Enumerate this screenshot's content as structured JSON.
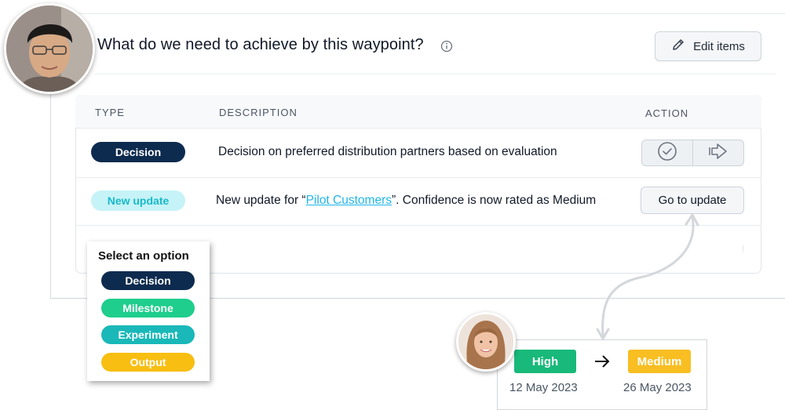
{
  "header": {
    "title": "What do we need to achieve by this waypoint?",
    "edit_label": "Edit items"
  },
  "table": {
    "columns": [
      "TYPE",
      "DESCRIPTION",
      "ACTION"
    ],
    "rows": [
      {
        "type": "Decision",
        "type_color": "#0d2b4e",
        "description": "Decision on preferred distribution partners based on evaluation"
      },
      {
        "type": "New update",
        "type_color": "#c6f3f7",
        "desc_before": "New update for “",
        "desc_link": "Pilot Customers",
        "desc_after": "”. Confidence is now rated as Medium",
        "action_label": "Go to update"
      }
    ]
  },
  "dropdown": {
    "title": "Select an option",
    "options": [
      {
        "label": "Decision",
        "color": "#0d2b4e"
      },
      {
        "label": "Milestone",
        "color": "#1fce8c"
      },
      {
        "label": "Experiment",
        "color": "#1ab8b8"
      },
      {
        "label": "Output",
        "color": "#f8be11"
      }
    ]
  },
  "confidence_change": {
    "from": {
      "label": "High",
      "date": "12 May 2023",
      "color": "#18b97a"
    },
    "to": {
      "label": "Medium",
      "date": "26 May 2023",
      "color": "#f8be22"
    }
  },
  "icons": [
    "info-icon",
    "pencil-icon",
    "check-circle-icon",
    "arrow-right-icon",
    "arrow-icon"
  ]
}
